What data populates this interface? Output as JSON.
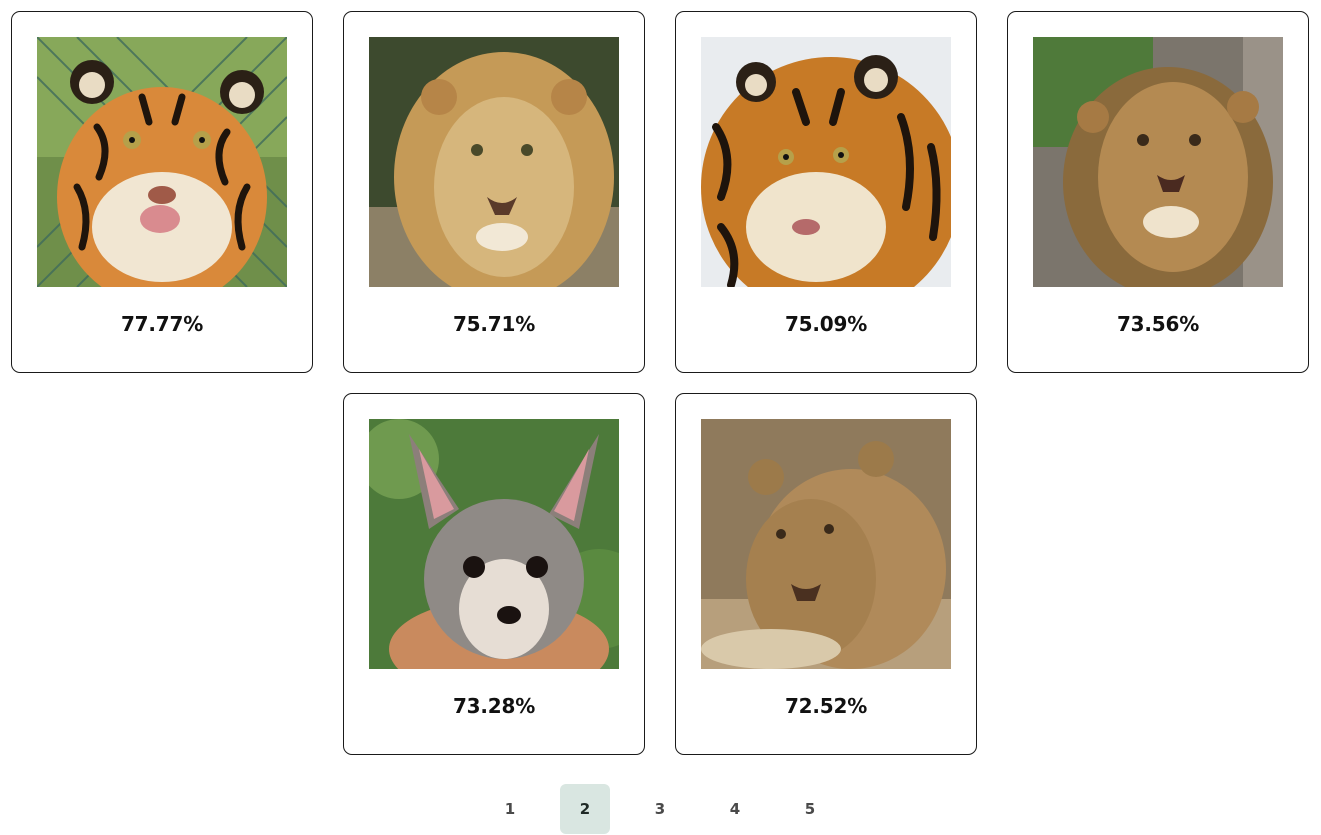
{
  "results": [
    {
      "score": "77.77%",
      "subject": "tiger-photo"
    },
    {
      "score": "75.71%",
      "subject": "lion-photo"
    },
    {
      "score": "75.09%",
      "subject": "tiger-photo"
    },
    {
      "score": "73.56%",
      "subject": "lion-photo"
    },
    {
      "score": "73.28%",
      "subject": "fox-photo"
    },
    {
      "score": "72.52%",
      "subject": "lioness-photo"
    }
  ],
  "pagination": {
    "pages": [
      "1",
      "2",
      "3",
      "4",
      "5"
    ],
    "current": "2"
  },
  "colors": {
    "active_page_bg": "#d9e6e1",
    "card_border": "#1a1a1a"
  }
}
